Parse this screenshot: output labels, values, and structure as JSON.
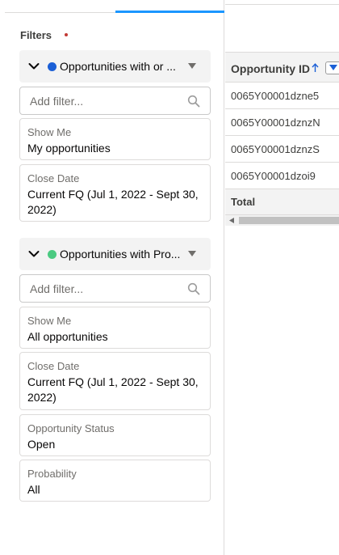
{
  "filters": {
    "title": "Filters",
    "groups": [
      {
        "title": "Opportunities with or ...",
        "dot_color": "#1b5fd6",
        "add_filter_placeholder": "Add filter...",
        "cards": [
          {
            "label": "Show Me",
            "value": "My opportunities"
          },
          {
            "label": "Close Date",
            "value": "Current FQ (Jul 1, 2022 - Sept 30, 2022)"
          }
        ]
      },
      {
        "title": "Opportunities with Pro...",
        "dot_color": "#4bca81",
        "add_filter_placeholder": "Add filter...",
        "cards": [
          {
            "label": "Show Me",
            "value": "All opportunities"
          },
          {
            "label": "Close Date",
            "value": "Current FQ (Jul 1, 2022 - Sept 30, 2022)"
          },
          {
            "label": "Opportunity Status",
            "value": "Open"
          },
          {
            "label": "Probability",
            "value": "All"
          }
        ]
      }
    ]
  },
  "report": {
    "column_header": "Opportunity ID",
    "rows": [
      "0065Y00001dzne5",
      "0065Y00001dznzN",
      "0065Y00001dznzS",
      "0065Y00001dzoi9"
    ],
    "total_label": "Total"
  },
  "icons": {
    "chevron": "chevron-down-icon",
    "caret": "caret-down-icon",
    "search": "search-icon",
    "sort": "sort-ascending-icon"
  },
  "colors": {
    "accent": "#1b96ff",
    "required": "#c23934",
    "header_bg": "#f3f3f3"
  }
}
